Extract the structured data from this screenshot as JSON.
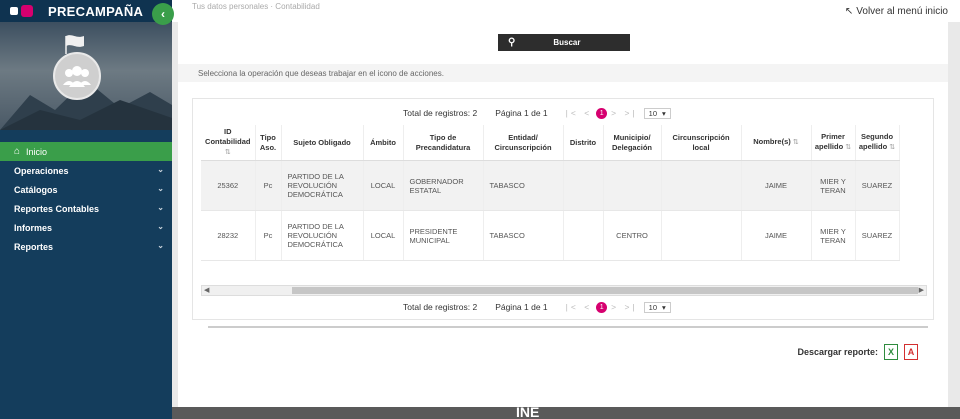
{
  "app": {
    "title": "PRECAMPAÑA",
    "collapse_icon": "chevron-left-icon"
  },
  "top": {
    "crumb": "Tus datos personales · Contabilidad",
    "back_label": "Volver al menú inicio"
  },
  "sidebar": {
    "items": [
      {
        "label": "Inicio",
        "active": true
      },
      {
        "label": "Operaciones"
      },
      {
        "label": "Catálogos"
      },
      {
        "label": "Reportes Contables"
      },
      {
        "label": "Informes"
      },
      {
        "label": "Reportes"
      }
    ]
  },
  "search": {
    "label": "Buscar"
  },
  "hint": "Selecciona la operación que deseas trabajar en el icono de acciones.",
  "pager": {
    "total": "Total de registros: 2",
    "page": "Página 1 de 1",
    "current": "1",
    "size": "10"
  },
  "table": {
    "headers": [
      "ID Contabilidad",
      "Tipo Aso.",
      "Sujeto Obligado",
      "Ámbito",
      "Tipo de Precandidatura",
      "Entidad/ Circunscripción",
      "Distrito",
      "Municipio/ Delegación",
      "Circunscripción local",
      "Nombre(s)",
      "Primer apellido",
      "Segundo apellido"
    ],
    "rows": [
      [
        "25362",
        "Pc",
        "PARTIDO DE LA REVOLUCIÓN DEMOCRÁTICA",
        "LOCAL",
        "GOBERNADOR ESTATAL",
        "TABASCO",
        "",
        "",
        "",
        "JAIME",
        "MIER Y TERAN",
        "SUAREZ"
      ],
      [
        "28232",
        "Pc",
        "PARTIDO DE LA REVOLUCIÓN DEMOCRÁTICA",
        "LOCAL",
        "PRESIDENTE MUNICIPAL",
        "TABASCO",
        "",
        "CENTRO",
        "",
        "JAIME",
        "MIER Y TERAN",
        "SUAREZ"
      ]
    ]
  },
  "download": {
    "label": "Descargar reporte:",
    "xls_glyph": "X",
    "pdf_glyph": "A"
  },
  "footer": {
    "logo": "INE"
  },
  "colors": {
    "sidebar": "#143d5c",
    "accent_green": "#3a9e4a",
    "brand_pink": "#d6006f"
  }
}
